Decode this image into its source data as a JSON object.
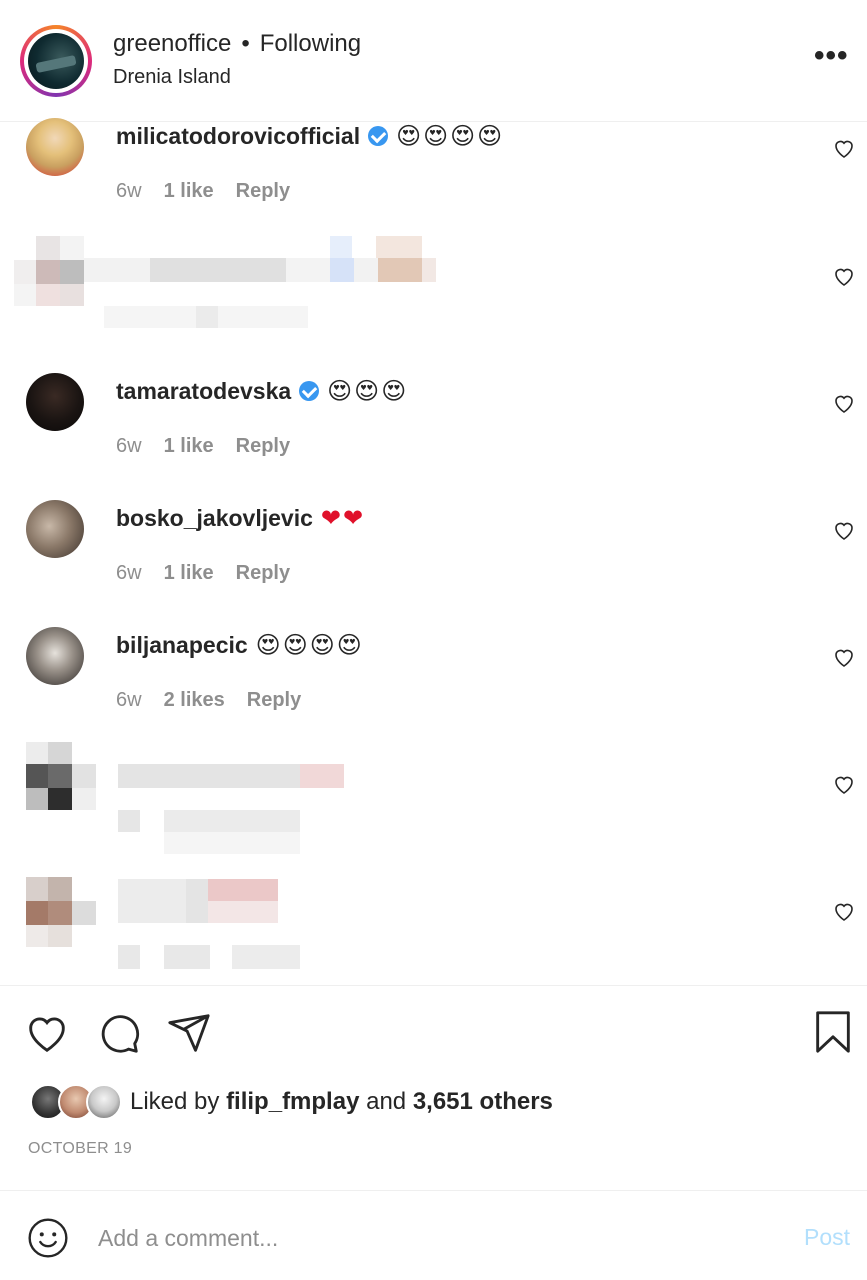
{
  "header": {
    "username": "greenoffice",
    "separator": "•",
    "follow_status": "Following",
    "location": "Drenia Island",
    "more": "•••"
  },
  "comments": [
    {
      "user": "milicatodorovicofficial",
      "verified": true,
      "emoji": "😍😍😍😍",
      "time": "6w",
      "likes": "1 like",
      "reply": "Reply"
    },
    {
      "user": "tamaratodevska",
      "verified": true,
      "emoji": "😍😍😍",
      "time": "6w",
      "likes": "1 like",
      "reply": "Reply"
    },
    {
      "user": "bosko_jakovljevic",
      "verified": false,
      "emoji": "❤❤",
      "time": "6w",
      "likes": "1 like",
      "reply": "Reply"
    },
    {
      "user": "biljanapecic",
      "verified": false,
      "emoji": "😍😍😍😍",
      "time": "6w",
      "likes": "2 likes",
      "reply": "Reply"
    }
  ],
  "liked_by": {
    "prefix": "Liked by",
    "user": "filip_fmplay",
    "joiner": "and",
    "others": "3,651 others"
  },
  "date": "OCTOBER 19",
  "add_comment": {
    "placeholder": "Add a comment...",
    "post_label": "Post"
  },
  "icons": {
    "more": "more-options-icon",
    "heart": "heart-icon",
    "comment": "comment-icon",
    "share": "share-icon",
    "save": "bookmark-icon",
    "emoji": "emoji-icon",
    "verified": "verified-badge-icon"
  },
  "colors": {
    "text": "#262626",
    "muted": "#8e8e8e",
    "verified": "#3897f0",
    "post_disabled": "#b2dffc"
  }
}
